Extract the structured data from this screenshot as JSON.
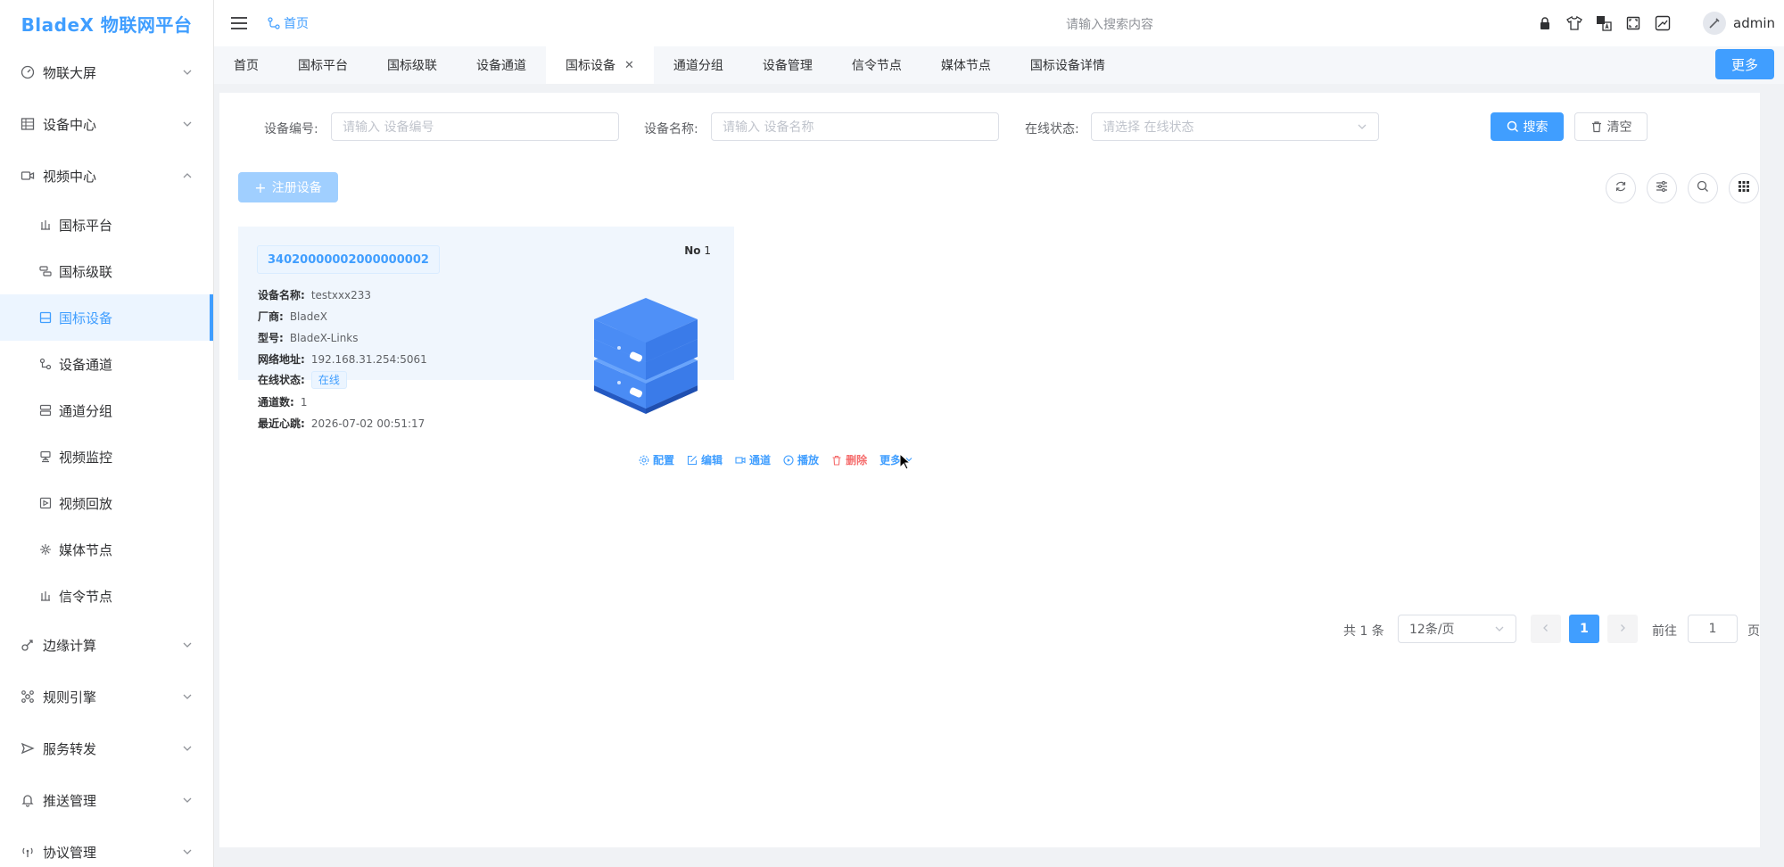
{
  "app": {
    "logo": "BladeX 物联网平台"
  },
  "sidebar": {
    "groups_top": [
      {
        "label": "物联大屏",
        "icon": "dashboard-icon"
      },
      {
        "label": "设备中心",
        "icon": "table-icon"
      },
      {
        "label": "视频中心",
        "icon": "video-camera-icon"
      }
    ],
    "sub_items": [
      {
        "label": "国标平台",
        "icon": "platform-icon"
      },
      {
        "label": "国标级联",
        "icon": "cascade-icon"
      },
      {
        "label": "国标设备",
        "icon": "device-icon",
        "active": true
      },
      {
        "label": "设备通道",
        "icon": "channel-icon"
      },
      {
        "label": "通道分组",
        "icon": "group-icon"
      },
      {
        "label": "视频监控",
        "icon": "monitor-icon"
      },
      {
        "label": "视频回放",
        "icon": "playback-icon"
      },
      {
        "label": "媒体节点",
        "icon": "media-node-icon"
      },
      {
        "label": "信令节点",
        "icon": "signal-node-icon"
      }
    ],
    "groups_bottom": [
      {
        "label": "边缘计算",
        "icon": "edge-icon"
      },
      {
        "label": "规则引擎",
        "icon": "rule-icon"
      },
      {
        "label": "服务转发",
        "icon": "send-icon"
      },
      {
        "label": "推送管理",
        "icon": "bell-icon"
      },
      {
        "label": "协议管理",
        "icon": "antenna-icon"
      }
    ]
  },
  "header": {
    "breadcrumb": "首页",
    "search_placeholder": "请输入搜索内容",
    "username": "admin"
  },
  "tabs": {
    "items": [
      "首页",
      "国标平台",
      "国标级联",
      "设备通道",
      "国标设备",
      "通道分组",
      "设备管理",
      "信令节点",
      "媒体节点",
      "国标设备详情"
    ],
    "active_index": 4,
    "more_label": "更多"
  },
  "filters": {
    "device_code_label": "设备编号:",
    "device_code_placeholder": "请输入 设备编号",
    "device_name_label": "设备名称:",
    "device_name_placeholder": "请输入 设备名称",
    "status_label": "在线状态:",
    "status_placeholder": "请选择 在线状态",
    "search_label": "搜索",
    "clear_label": "清空"
  },
  "toolbar": {
    "register_label": "注册设备"
  },
  "device_card": {
    "id": "34020000002000000002",
    "no_label": "No",
    "no_value": "1",
    "rows": {
      "name_key": "设备名称:",
      "name_val": "testxxx233",
      "vendor_key": "厂商:",
      "vendor_val": "BladeX",
      "model_key": "型号:",
      "model_val": "BladeX-Links",
      "address_key": "网络地址:",
      "address_val": "192.168.31.254:5061",
      "status_key": "在线状态:",
      "status_val": "在线",
      "channels_key": "通道数:",
      "channels_val": "1",
      "heartbeat_key": "最近心跳:",
      "heartbeat_val": "2026-07-02 00:51:17"
    },
    "actions": {
      "config": "配置",
      "edit": "编辑",
      "channel": "通道",
      "play": "播放",
      "delete": "删除",
      "more": "更多"
    }
  },
  "pagination": {
    "total": "共 1 条",
    "page_size": "12条/页",
    "current_page": "1",
    "goto_label": "前往",
    "goto_value": "1",
    "page_suffix": "页"
  },
  "colors": {
    "primary": "#409eff",
    "danger": "#f56c6c"
  }
}
